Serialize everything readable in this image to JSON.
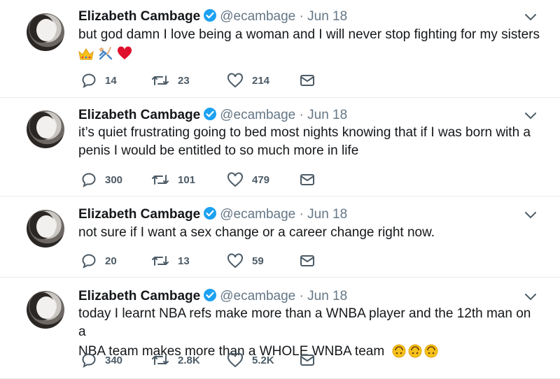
{
  "tweets": [
    {
      "name": "Elizabeth Cambage",
      "handle": "@ecambage",
      "date": "Jun 18",
      "text": "but god damn I love being a woman and I will never stop fighting for my sisters",
      "emoji_line": [
        "crown-emoji",
        "cartwheel-emoji",
        "red-heart-emoji"
      ],
      "replies": "14",
      "retweets": "23",
      "likes": "214"
    },
    {
      "name": "Elizabeth Cambage",
      "handle": "@ecambage",
      "date": "Jun 18",
      "text_line1": "it’s quiet frustrating going to bed most nights knowing that if I was born with a",
      "text_line2": "penis I would be entitled to so much more in life",
      "replies": "300",
      "retweets": "101",
      "likes": "479"
    },
    {
      "name": "Elizabeth Cambage",
      "handle": "@ecambage",
      "date": "Jun 18",
      "text": "not sure if I want a sex change or a career change right now.",
      "replies": "20",
      "retweets": "13",
      "likes": "59"
    },
    {
      "name": "Elizabeth Cambage",
      "handle": "@ecambage",
      "date": "Jun 18",
      "text_line1": "today I learnt NBA refs make more than a WNBA player and the 12th man on a",
      "text_line2": "NBA team makes more than a WHOLE WNBA team",
      "emoji_trailing": [
        "upside-down-face-emoji",
        "upside-down-face-emoji",
        "upside-down-face-emoji"
      ],
      "replies": "340",
      "retweets": "2.8K",
      "likes": "5.2K"
    }
  ],
  "separator": "·",
  "colors": {
    "verified": "#1da1f2",
    "icon": "#4c5b66",
    "muted": "#657786",
    "heart_emoji": "#e0102c",
    "divider": "#e6ecf0"
  }
}
